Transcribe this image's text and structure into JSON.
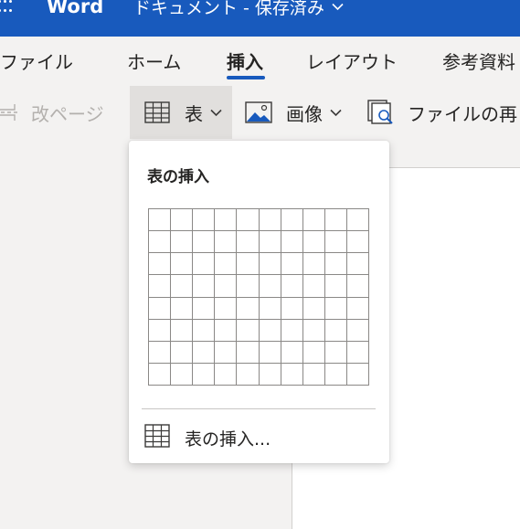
{
  "app": {
    "name": "Word",
    "document_title": "ドキュメント - 保存済み"
  },
  "tabs": [
    {
      "label": "ファイル",
      "active": false
    },
    {
      "label": "ホーム",
      "active": false
    },
    {
      "label": "挿入",
      "active": true
    },
    {
      "label": "レイアウト",
      "active": false
    },
    {
      "label": "参考資料",
      "active": false
    }
  ],
  "toolbar": {
    "page_break": {
      "label": "改ページ",
      "icon": "page-break-icon",
      "enabled": false
    },
    "table": {
      "label": "表",
      "icon": "table-icon",
      "expanded": true
    },
    "image": {
      "label": "画像",
      "icon": "image-icon"
    },
    "file_reuse": {
      "label": "ファイルの再",
      "icon": "file-reuse-icon"
    }
  },
  "table_menu": {
    "heading": "表の挿入",
    "grid": {
      "columns": 10,
      "rows": 8
    },
    "insert_item_label": "表の挿入..."
  },
  "colors": {
    "title_bar": "#185abd",
    "accent": "#185abd",
    "ribbon_bg": "#f3f2f1",
    "grid_line": "#8a8886"
  }
}
